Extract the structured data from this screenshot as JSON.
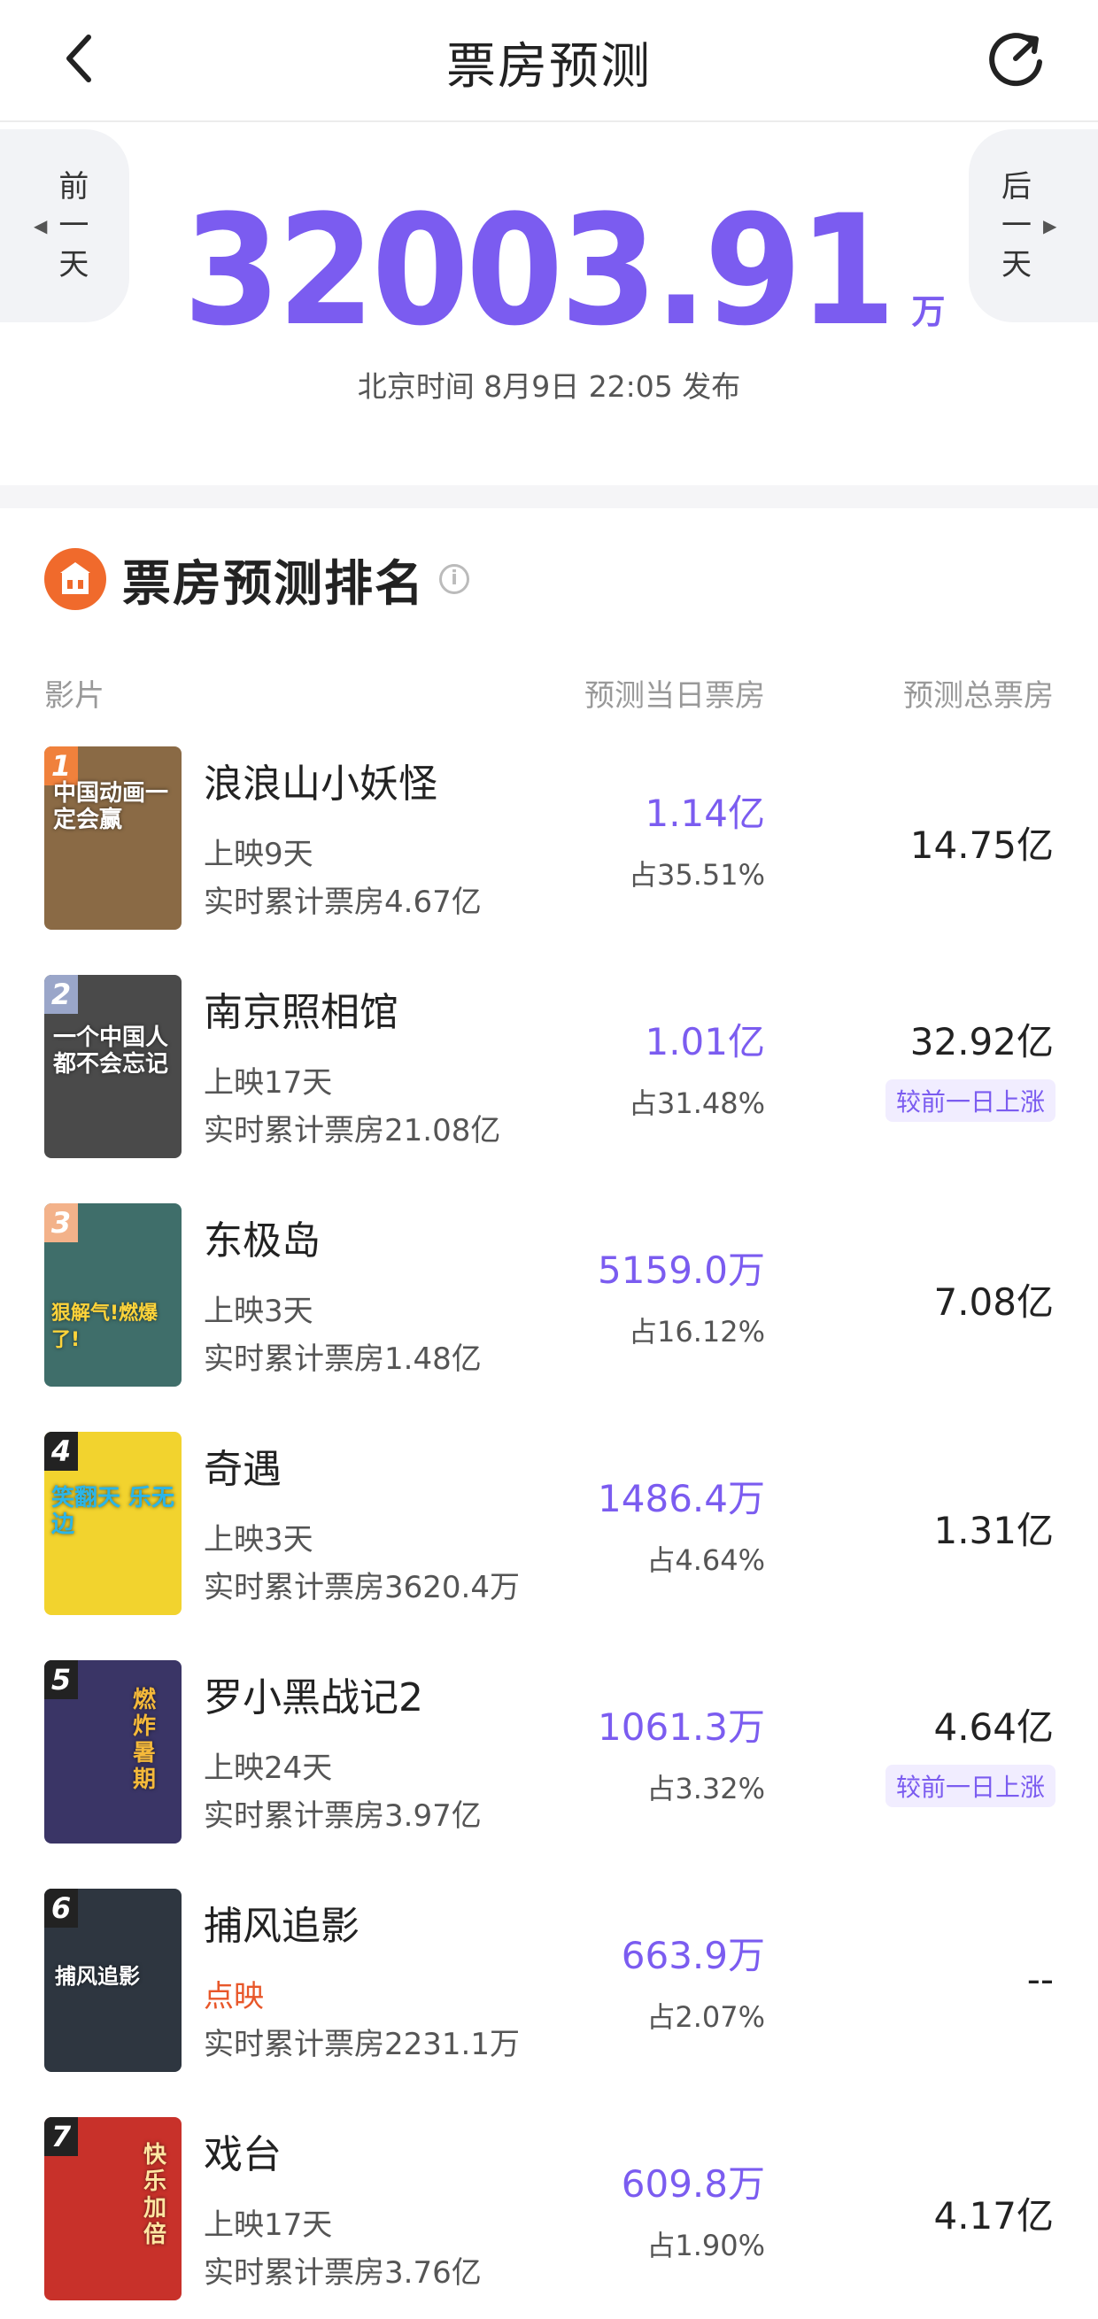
{
  "header": {
    "title": "票房预测",
    "back_icon": "chevron-left-icon",
    "refresh_icon": "refresh-icon"
  },
  "summary": {
    "prev_day_label": "前一天",
    "next_day_label": "后一天",
    "total_value": "32003.91",
    "total_unit": "万",
    "publish_time": "北京时间 8月9日 22:05 发布"
  },
  "ranking": {
    "title": "票房预测排名",
    "columns": {
      "film": "影片",
      "day_box": "预测当日票房",
      "total_box": "预测总票房"
    },
    "films": [
      {
        "rank": "1",
        "name": "浪浪山小妖怪",
        "days": "上映9天",
        "cumulative": "实时累计票房4.67亿",
        "day_value": "1.14亿",
        "share": "占35.51%",
        "total": "14.75亿",
        "badge": "",
        "poster_text": "中国动画一定会赢",
        "poster_color": "#8a6a45",
        "badge_color": "#f0813c"
      },
      {
        "rank": "2",
        "name": "南京照相馆",
        "days": "上映17天",
        "cumulative": "实时累计票房21.08亿",
        "day_value": "1.01亿",
        "share": "占31.48%",
        "total": "32.92亿",
        "badge": "较前一日上涨",
        "poster_text": "一个中国人都不会忘记",
        "poster_color": "#4a4a4a",
        "badge_color": "#9aa6c9"
      },
      {
        "rank": "3",
        "name": "东极岛",
        "days": "上映3天",
        "cumulative": "实时累计票房1.48亿",
        "day_value": "5159.0万",
        "share": "占16.12%",
        "total": "7.08亿",
        "badge": "",
        "poster_text": "狠解气!燃爆了!",
        "poster_color": "#3f6e6a",
        "badge_color": "#f3b28a"
      },
      {
        "rank": "4",
        "name": "奇遇",
        "days": "上映3天",
        "cumulative": "实时累计票房3620.4万",
        "day_value": "1486.4万",
        "share": "占4.64%",
        "total": "1.31亿",
        "badge": "",
        "poster_text": "笑翻天 乐无边",
        "poster_color": "#f2d32e",
        "badge_color": "#222222"
      },
      {
        "rank": "5",
        "name": "罗小黑战记2",
        "days": "上映24天",
        "cumulative": "实时累计票房3.97亿",
        "day_value": "1061.3万",
        "share": "占3.32%",
        "total": "4.64亿",
        "badge": "较前一日上涨",
        "poster_text": "燃炸暑期",
        "poster_color": "#3a3566",
        "badge_color": "#222222"
      },
      {
        "rank": "6",
        "name": "捕风追影",
        "days": "点映",
        "cumulative": "实时累计票房2231.1万",
        "day_value": "663.9万",
        "share": "占2.07%",
        "total": "--",
        "badge": "",
        "poster_text": "捕风追影",
        "poster_color": "#2e3640",
        "badge_color": "#222222"
      },
      {
        "rank": "7",
        "name": "戏台",
        "days": "上映17天",
        "cumulative": "实时累计票房3.76亿",
        "day_value": "609.8万",
        "share": "占1.90%",
        "total": "4.17亿",
        "badge": "",
        "poster_text": "快乐加倍",
        "poster_color": "#c8312a",
        "badge_color": "#222222"
      }
    ]
  },
  "colors": {
    "accent_purple": "#7b5cf0",
    "preview_orange": "#e8572a",
    "section_icon_orange": "#f06a2c"
  }
}
